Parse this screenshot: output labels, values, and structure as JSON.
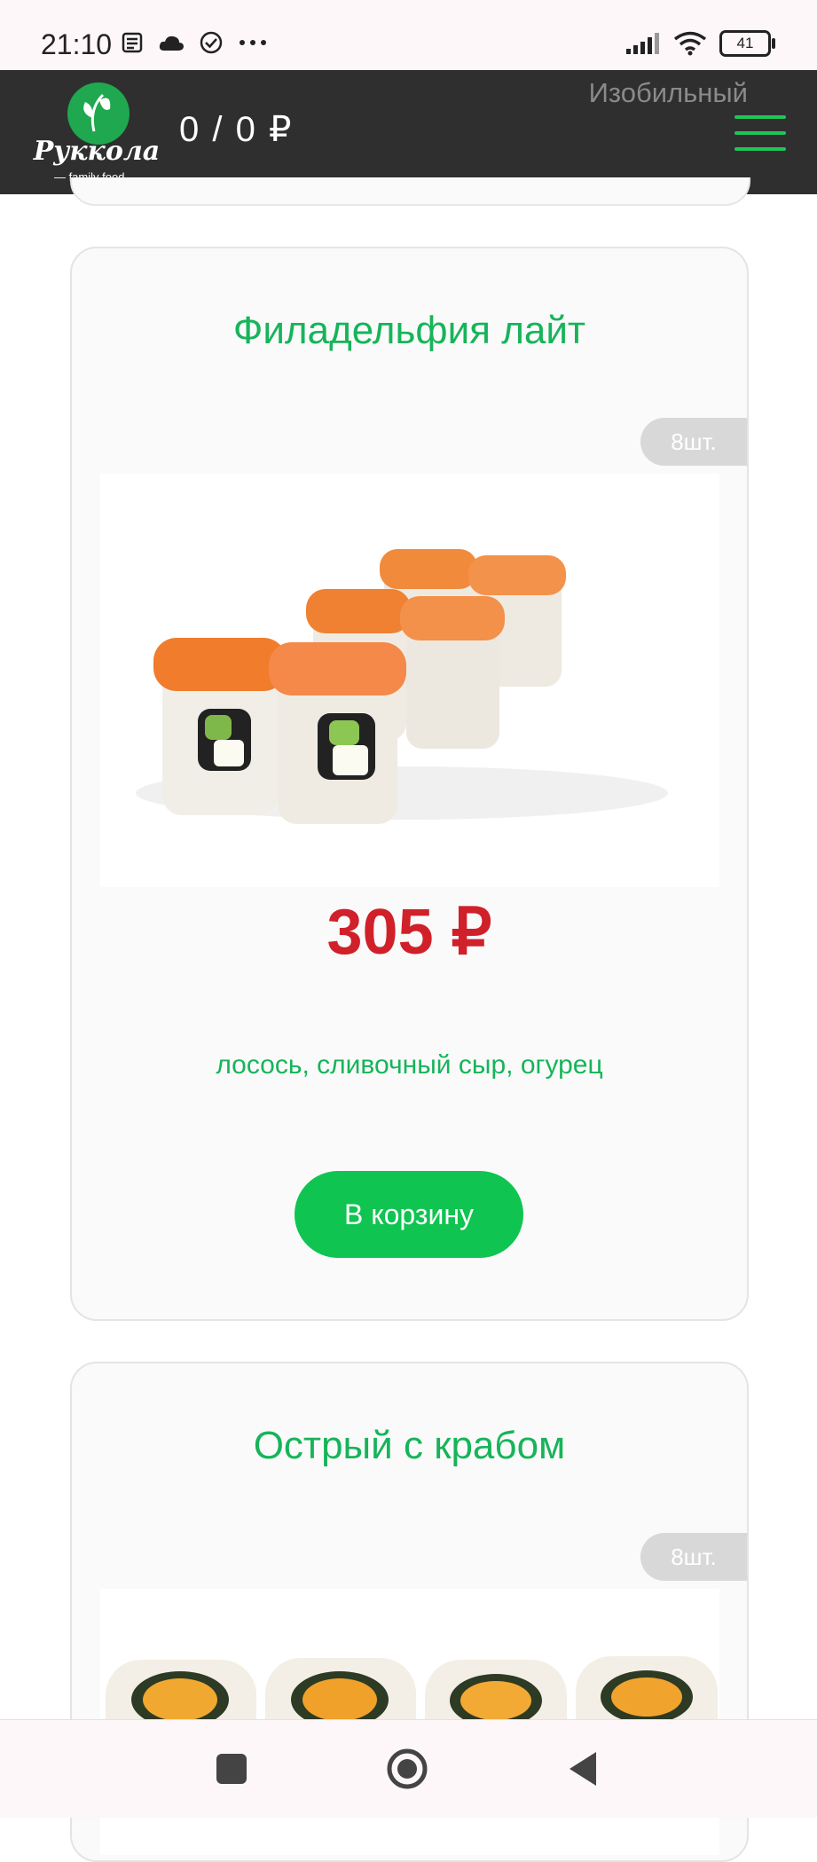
{
  "status_bar": {
    "time": "21:10",
    "left_icons": [
      "news-icon",
      "cloud-icon",
      "check-circle-icon",
      "more-icon"
    ],
    "right_icons": [
      "signal-icon",
      "wifi-icon",
      "battery-icon"
    ],
    "battery_level": "41"
  },
  "header": {
    "logo_text": "Руккола",
    "logo_subtitle": "— family food —",
    "cart_summary": "0 / 0 ₽",
    "city": "Изобильный",
    "menu_icon": "hamburger-icon"
  },
  "products": [
    {
      "title": "Филадельфия лайт",
      "pieces": "8шт.",
      "price": "305 ₽",
      "ingredients": "лосось, сливочный сыр, огурец",
      "button": "В корзину"
    },
    {
      "title": "Острый с крабом",
      "pieces": "8шт."
    }
  ],
  "nav_bar": {
    "icons": [
      "square-icon",
      "home-circle-icon",
      "back-triangle-icon"
    ]
  },
  "colors": {
    "accent_green": "#17b45a",
    "button_green": "#0fc450",
    "price_red": "#d0202a",
    "header_bg": "#2f2f2f"
  }
}
